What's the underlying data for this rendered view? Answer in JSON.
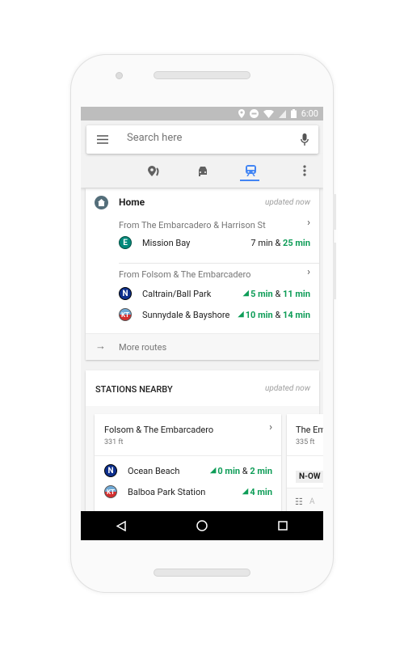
{
  "status_bar": {
    "time": "6:00",
    "icons": [
      "location-icon",
      "do-not-disturb-icon",
      "wifi-icon",
      "signal-icon",
      "battery-icon"
    ]
  },
  "search": {
    "placeholder": "Search here",
    "menu_icon": "hamburger-menu-icon",
    "mic_icon": "mic-icon"
  },
  "tabs": [
    {
      "icon": "explore-pin-icon"
    },
    {
      "icon": "car-icon"
    },
    {
      "icon": "train-icon",
      "active": true
    },
    {
      "icon": "more-vert-icon"
    }
  ],
  "accent": "#4285f4",
  "realtime_color": "#0f9d58",
  "home": {
    "title": "Home",
    "updated": "updated now",
    "groups": [
      {
        "from": "From The Embarcadero & Harrison St",
        "routes": [
          {
            "line": "E",
            "dest": "Mission Bay",
            "time1": "7 min",
            "sep": " & ",
            "time2": "25 min",
            "t1_live": false,
            "t2_live": true
          }
        ]
      },
      {
        "from": "From Folsom & The Embarcadero",
        "routes": [
          {
            "line": "N",
            "dest": "Caltrain/Ball Park",
            "time1": "5 min",
            "sep": " & ",
            "time2": "11 min",
            "t1_live": true,
            "t2_live": true
          },
          {
            "line": "KT",
            "dest": "Sunnydale & Bayshore",
            "time1": "10 min",
            "sep": " & ",
            "time2": "14 min",
            "t1_live": true,
            "t2_live": true
          }
        ]
      }
    ],
    "more_routes": "More routes"
  },
  "stations": {
    "title": "STATIONS NEARBY",
    "updated": "updated now",
    "cards": [
      {
        "name": "Folsom & The Embarcadero",
        "distance": "331 ft",
        "routes": [
          {
            "line": "N",
            "dest": "Ocean Beach",
            "time1": "0 min",
            "sep": " & ",
            "time2": "2 min"
          },
          {
            "line": "KT",
            "dest": "Balboa Park Station",
            "time1": "4 min"
          }
        ]
      },
      {
        "name": "The Em",
        "distance": "335 ft",
        "chip": "N-OW",
        "footer": "A"
      }
    ]
  },
  "nav": {
    "back": "back-icon",
    "home": "home-icon",
    "recents": "recents-icon"
  }
}
